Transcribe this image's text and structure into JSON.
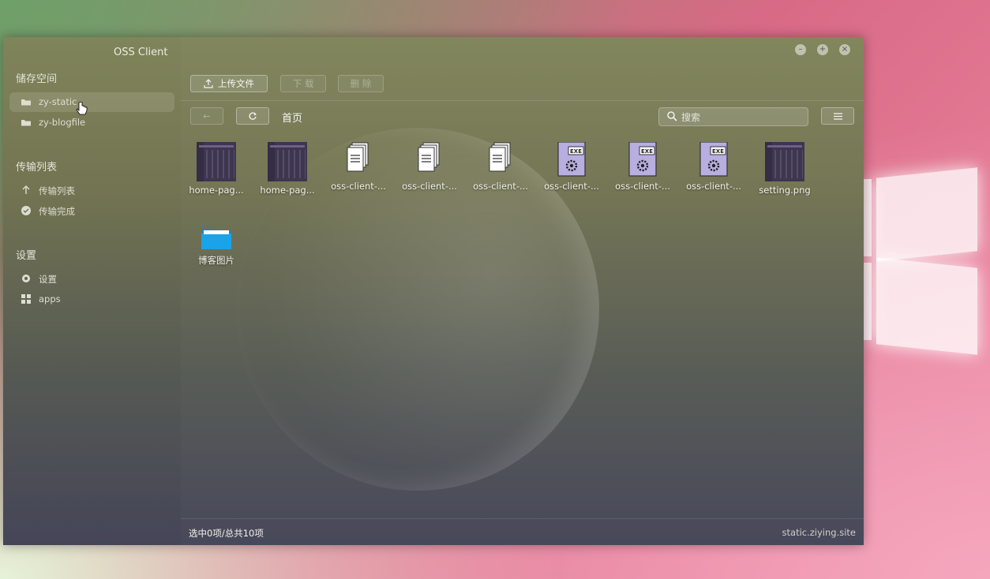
{
  "app": {
    "title": "OSS Client"
  },
  "sidebar": {
    "storage_heading": "储存空间",
    "buckets": [
      {
        "label": "zy-static",
        "icon": "folder-icon",
        "active": true
      },
      {
        "label": "zy-blogfile",
        "icon": "folder-icon",
        "active": false
      }
    ],
    "transfer_heading": "传输列表",
    "transfers": [
      {
        "label": "传输列表",
        "icon": "upload-arrow-icon"
      },
      {
        "label": "传输完成",
        "icon": "check-circle-icon"
      }
    ],
    "settings_heading": "设置",
    "settings": [
      {
        "label": "设置",
        "icon": "gear-icon"
      },
      {
        "label": "apps",
        "icon": "grid-icon"
      }
    ]
  },
  "toolbar": {
    "upload_label": "上传文件",
    "download_label": "下 载",
    "delete_label": "删 除"
  },
  "navbar": {
    "breadcrumb": "首页",
    "search_placeholder": "搜索"
  },
  "files": [
    {
      "name": "home-pag...",
      "type": "image"
    },
    {
      "name": "home-pag...",
      "type": "image"
    },
    {
      "name": "oss-client-...",
      "type": "document"
    },
    {
      "name": "oss-client-...",
      "type": "document"
    },
    {
      "name": "oss-client-...",
      "type": "document"
    },
    {
      "name": "oss-client-...",
      "type": "exe"
    },
    {
      "name": "oss-client-...",
      "type": "exe"
    },
    {
      "name": "oss-client-...",
      "type": "exe"
    },
    {
      "name": "setting.png",
      "type": "image"
    },
    {
      "name": "博客图片",
      "type": "folder"
    }
  ],
  "status": {
    "selection": "选中0项/总共10项",
    "domain": "static.ziying.site"
  },
  "colors": {
    "accent_folder": "#1aa3e8",
    "exe_icon": "#b8aee0"
  }
}
